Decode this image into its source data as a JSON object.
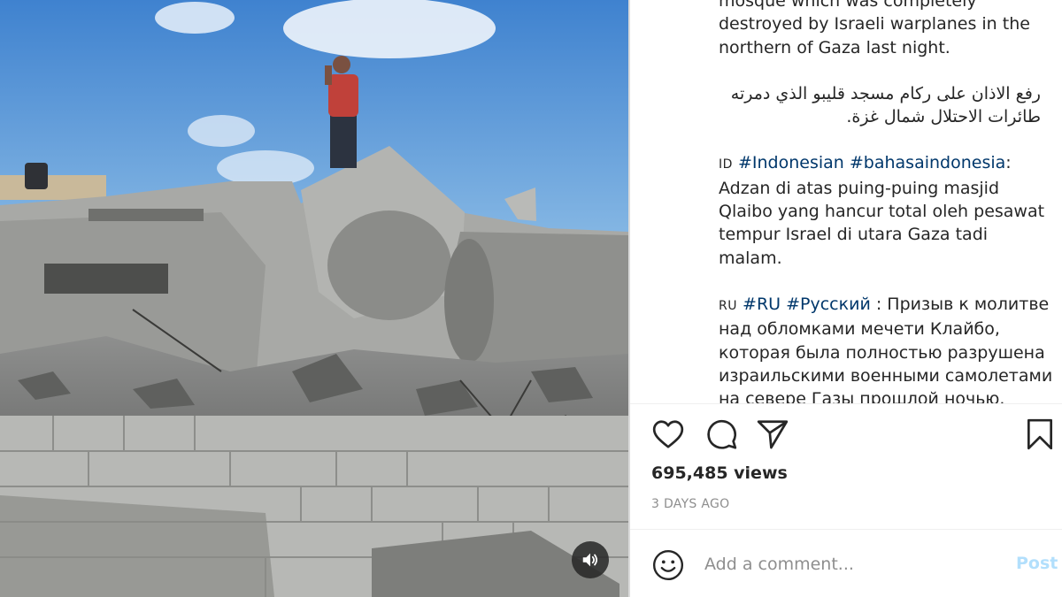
{
  "post": {
    "caption": {
      "english_lines": [
        "mosque which was completely",
        "destroyed by Israeli warplanes in the",
        "northern of Gaza last night."
      ],
      "arabic": "رفع الاذان على ركام مسجد قليبو الذي دمرته طائرات الاحتلال شمال غزة.",
      "indonesian": {
        "code": "ID",
        "tags": [
          "#Indonesian",
          "#bahasaindonesia"
        ],
        "text": "Adzan di atas puing-puing masjid Qlaibo yang hancur total oleh pesawat tempur Israel di utara Gaza tadi malam."
      },
      "russian": {
        "code": "RU",
        "tags": [
          "#RU",
          "#Русский"
        ],
        "text": "Призыв к молитве над обломками мечети Клайбо, которая была полностью разрушена израильскими военными самолетами на севере Газы прошлой ночью."
      }
    },
    "actions": {
      "like_icon": "heart-icon",
      "comment_icon": "comment-bubble-icon",
      "share_icon": "paper-plane-icon",
      "save_icon": "bookmark-icon"
    },
    "views": "695,485 views",
    "date": "3 DAYS AGO",
    "comment_box": {
      "emoji_icon": "emoji-icon",
      "placeholder": "Add a comment...",
      "post_label": "Post"
    }
  },
  "media": {
    "sound_icon": "speaker-icon"
  },
  "colors": {
    "text": "#262626",
    "hashtag": "#00376b",
    "muted": "#8e8e8e",
    "post_disabled": "#b2dffc",
    "divider": "#dbdbdb"
  }
}
